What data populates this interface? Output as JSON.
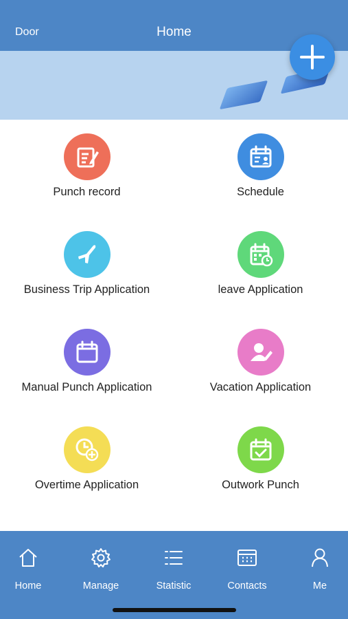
{
  "header": {
    "left_label": "Door",
    "title": "Home"
  },
  "fab": {
    "icon": "plus-icon"
  },
  "grid": [
    {
      "label": "Punch record",
      "icon": "document-edit-icon",
      "color": "#ee6f59"
    },
    {
      "label": "Schedule",
      "icon": "calendar-person-icon",
      "color": "#3f8de0"
    },
    {
      "label": "Business Trip Application",
      "icon": "airplane-icon",
      "color": "#4dc3e8"
    },
    {
      "label": "leave Application",
      "icon": "calendar-clock-icon",
      "color": "#5fd87a"
    },
    {
      "label": "Manual Punch Application",
      "icon": "calendar-icon",
      "color": "#7b6de2"
    },
    {
      "label": "Vacation Application",
      "icon": "user-edit-icon",
      "color": "#e87cc8"
    },
    {
      "label": "Overtime Application",
      "icon": "clock-plus-icon",
      "color": "#f4dd55"
    },
    {
      "label": "Outwork Punch",
      "icon": "calendar-check-icon",
      "color": "#7ed84a"
    }
  ],
  "tabbar": [
    {
      "label": "Home",
      "icon": "home-icon"
    },
    {
      "label": "Manage",
      "icon": "gear-icon"
    },
    {
      "label": "Statistic",
      "icon": "list-icon"
    },
    {
      "label": "Contacts",
      "icon": "contacts-icon"
    },
    {
      "label": "Me",
      "icon": "person-icon"
    }
  ],
  "colors": {
    "header": "#4d86c6",
    "banner": "#b7d3ef",
    "fab": "#3b8ee3"
  }
}
